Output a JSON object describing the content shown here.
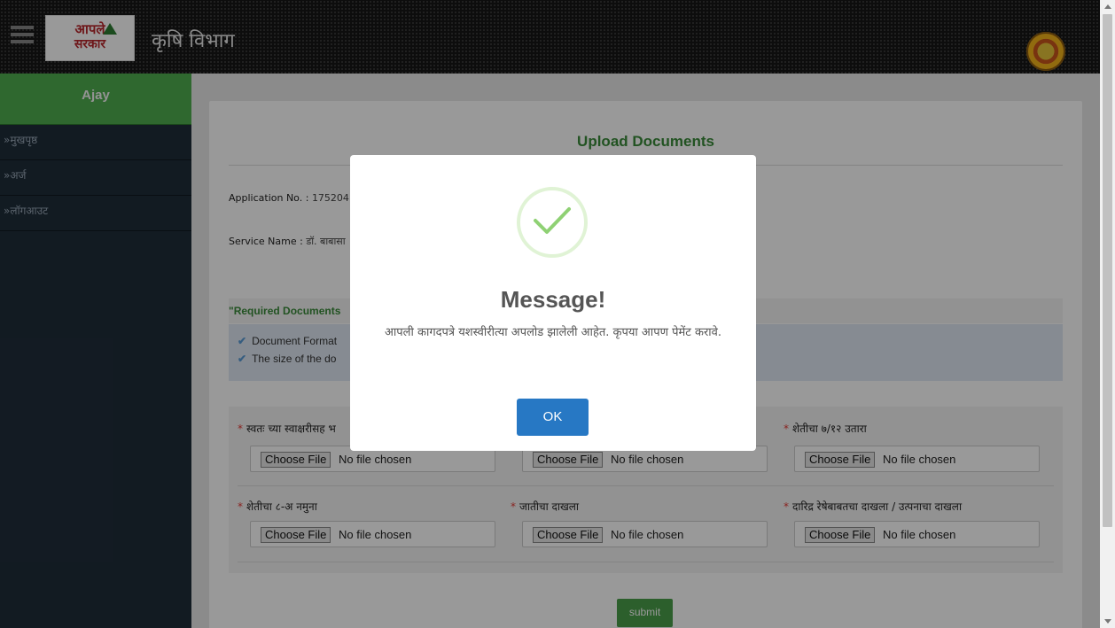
{
  "header": {
    "logo_line1": "आपले",
    "logo_line2": "सरकार",
    "title": "कृषि विभाग",
    "menu_icon": "hamburger-icon",
    "emblem_icon": "government-emblem"
  },
  "sidebar": {
    "user": "Ajay",
    "items": [
      {
        "label": "»मुखपृष्ठ"
      },
      {
        "label": "»अर्ज"
      },
      {
        "label": "»लॉगआउट"
      }
    ]
  },
  "page": {
    "title": "Upload Documents",
    "application_label": "Application No. :",
    "application_value": "175204",
    "service_label": "Service Name :",
    "service_value": "डॉ. बाबासा",
    "required_heading": "\"Required Documents",
    "formats": [
      "Document Format",
      "The size of the do"
    ],
    "submit_label": "submit"
  },
  "uploads": [
    {
      "label": "स्वतः च्या स्वाक्षरीसह भ",
      "button": "Choose File",
      "status": "No file chosen"
    },
    {
      "label": "",
      "button": "Choose File",
      "status": "No file chosen"
    },
    {
      "label": "शेतीचा ७/१२ उतारा",
      "button": "Choose File",
      "status": "No file chosen"
    },
    {
      "label": "शेतीचा ८-अ नमुना",
      "button": "Choose File",
      "status": "No file chosen"
    },
    {
      "label": "जातीचा दाखला",
      "button": "Choose File",
      "status": "No file chosen"
    },
    {
      "label": "दारिद्र रेषेबाबतचा दाखला / उत्पनाचा दाखला",
      "button": "Choose File",
      "status": "No file chosen"
    }
  ],
  "modal": {
    "icon": "success-check-icon",
    "title": "Message!",
    "text": "आपली कागदपत्रे यशस्वीरीत्या अपलोड झालेली आहेत. कृपया आपण पेमेंट करावे.",
    "ok_label": "OK"
  },
  "colors": {
    "accent_green": "#4fae4f",
    "sidebar_bg": "#1f2d3a",
    "ok_blue": "#2778c4",
    "required_star": "#e53935"
  }
}
